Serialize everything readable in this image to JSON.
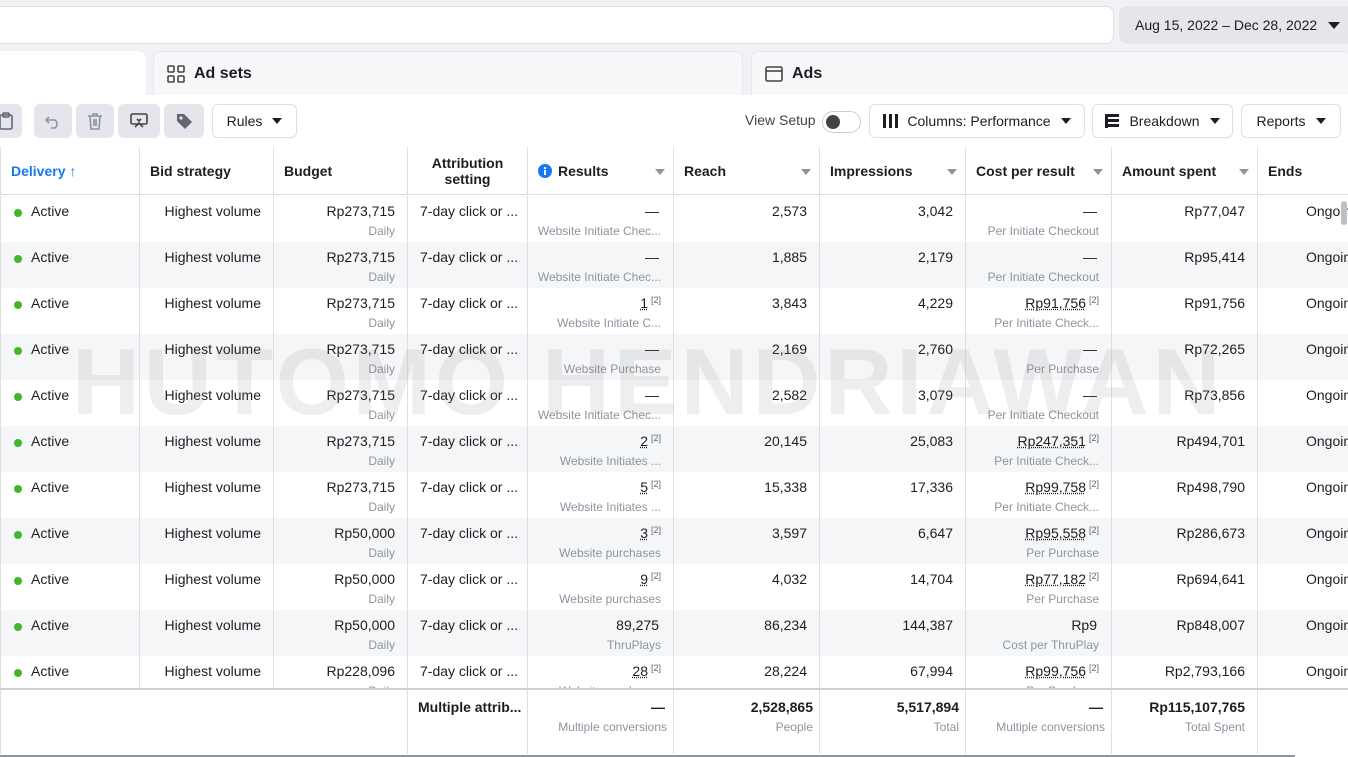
{
  "date_range": "Aug 15, 2022 – Dec 28, 2022",
  "tabs": {
    "adsets": "Ad sets",
    "ads": "Ads"
  },
  "toolbar": {
    "rules": "Rules",
    "view_setup": "View Setup",
    "columns": "Columns: Performance",
    "breakdown": "Breakdown",
    "reports": "Reports"
  },
  "columns": {
    "delivery": "Delivery ↑",
    "bid_strategy": "Bid strategy",
    "budget": "Budget",
    "attribution": "Attribution setting",
    "results": "Results",
    "reach": "Reach",
    "impressions": "Impressions",
    "cost_per_result": "Cost per result",
    "amount_spent": "Amount spent",
    "ends": "Ends"
  },
  "rows": [
    {
      "delivery": "Active",
      "bid": "Highest volume",
      "budget": "Rp273,715",
      "budget_sub": "Daily",
      "attr": "7-day click or ...",
      "results": "—",
      "results_sup": "",
      "results_sub": "Website Initiate Chec...",
      "reach": "2,573",
      "impr": "3,042",
      "cpr": "—",
      "cpr_sup": "",
      "cpr_sub": "Per Initiate Checkout",
      "spent": "Rp77,047",
      "ends": "Ongoing"
    },
    {
      "delivery": "Active",
      "bid": "Highest volume",
      "budget": "Rp273,715",
      "budget_sub": "Daily",
      "attr": "7-day click or ...",
      "results": "—",
      "results_sup": "",
      "results_sub": "Website Initiate Chec...",
      "reach": "1,885",
      "impr": "2,179",
      "cpr": "—",
      "cpr_sup": "",
      "cpr_sub": "Per Initiate Checkout",
      "spent": "Rp95,414",
      "ends": "Ongoing"
    },
    {
      "delivery": "Active",
      "bid": "Highest volume",
      "budget": "Rp273,715",
      "budget_sub": "Daily",
      "attr": "7-day click or ...",
      "results": "1",
      "results_sup": "[2]",
      "results_sub": "Website Initiate C...",
      "reach": "3,843",
      "impr": "4,229",
      "cpr": "Rp91,756",
      "cpr_sup": "[2]",
      "cpr_sub": "Per Initiate Check...",
      "spent": "Rp91,756",
      "ends": "Ongoing"
    },
    {
      "delivery": "Active",
      "bid": "Highest volume",
      "budget": "Rp273,715",
      "budget_sub": "Daily",
      "attr": "7-day click or ...",
      "results": "—",
      "results_sup": "",
      "results_sub": "Website Purchase",
      "reach": "2,169",
      "impr": "2,760",
      "cpr": "—",
      "cpr_sup": "",
      "cpr_sub": "Per Purchase",
      "spent": "Rp72,265",
      "ends": "Ongoing"
    },
    {
      "delivery": "Active",
      "bid": "Highest volume",
      "budget": "Rp273,715",
      "budget_sub": "Daily",
      "attr": "7-day click or ...",
      "results": "—",
      "results_sup": "",
      "results_sub": "Website Initiate Chec...",
      "reach": "2,582",
      "impr": "3,079",
      "cpr": "—",
      "cpr_sup": "",
      "cpr_sub": "Per Initiate Checkout",
      "spent": "Rp73,856",
      "ends": "Ongoing"
    },
    {
      "delivery": "Active",
      "bid": "Highest volume",
      "budget": "Rp273,715",
      "budget_sub": "Daily",
      "attr": "7-day click or ...",
      "results": "2",
      "results_sup": "[2]",
      "results_sub": "Website Initiates ...",
      "reach": "20,145",
      "impr": "25,083",
      "cpr": "Rp247,351",
      "cpr_sup": "[2]",
      "cpr_sub": "Per Initiate Check...",
      "spent": "Rp494,701",
      "ends": "Ongoing"
    },
    {
      "delivery": "Active",
      "bid": "Highest volume",
      "budget": "Rp273,715",
      "budget_sub": "Daily",
      "attr": "7-day click or ...",
      "results": "5",
      "results_sup": "[2]",
      "results_sub": "Website Initiates ...",
      "reach": "15,338",
      "impr": "17,336",
      "cpr": "Rp99,758",
      "cpr_sup": "[2]",
      "cpr_sub": "Per Initiate Check...",
      "spent": "Rp498,790",
      "ends": "Ongoing"
    },
    {
      "delivery": "Active",
      "bid": "Highest volume",
      "budget": "Rp50,000",
      "budget_sub": "Daily",
      "attr": "7-day click or ...",
      "results": "3",
      "results_sup": "[2]",
      "results_sub": "Website purchases",
      "reach": "3,597",
      "impr": "6,647",
      "cpr": "Rp95,558",
      "cpr_sup": "[2]",
      "cpr_sub": "Per Purchase",
      "spent": "Rp286,673",
      "ends": "Ongoing"
    },
    {
      "delivery": "Active",
      "bid": "Highest volume",
      "budget": "Rp50,000",
      "budget_sub": "Daily",
      "attr": "7-day click or ...",
      "results": "9",
      "results_sup": "[2]",
      "results_sub": "Website purchases",
      "reach": "4,032",
      "impr": "14,704",
      "cpr": "Rp77,182",
      "cpr_sup": "[2]",
      "cpr_sub": "Per Purchase",
      "spent": "Rp694,641",
      "ends": "Ongoing"
    },
    {
      "delivery": "Active",
      "bid": "Highest volume",
      "budget": "Rp50,000",
      "budget_sub": "Daily",
      "attr": "7-day click or ...",
      "results": "89,275",
      "results_sup": "",
      "results_sub": "ThruPlays",
      "reach": "86,234",
      "impr": "144,387",
      "cpr": "Rp9",
      "cpr_sup": "",
      "cpr_sub": "Cost per ThruPlay",
      "spent": "Rp848,007",
      "ends": "Ongoing"
    },
    {
      "delivery": "Active",
      "bid": "Highest volume",
      "budget": "Rp228,096",
      "budget_sub": "Daily",
      "attr": "7-day click or ...",
      "results": "28",
      "results_sup": "[2]",
      "results_sub": "Website purchases",
      "reach": "28,224",
      "impr": "67,994",
      "cpr": "Rp99,756",
      "cpr_sup": "[2]",
      "cpr_sub": "Per Purchase",
      "spent": "Rp2,793,166",
      "ends": "Ongoing"
    }
  ],
  "footer": {
    "attr": "Multiple attrib...",
    "results": "—",
    "results_sub": "Multiple conversions",
    "reach": "2,528,865",
    "reach_sub": "People",
    "impr": "5,517,894",
    "impr_sub": "Total",
    "cpr": "—",
    "cpr_sub": "Multiple conversions",
    "spent": "Rp115,107,765",
    "spent_sub": "Total Spent"
  },
  "watermark": "HUTOMO HENDRIAWAN"
}
